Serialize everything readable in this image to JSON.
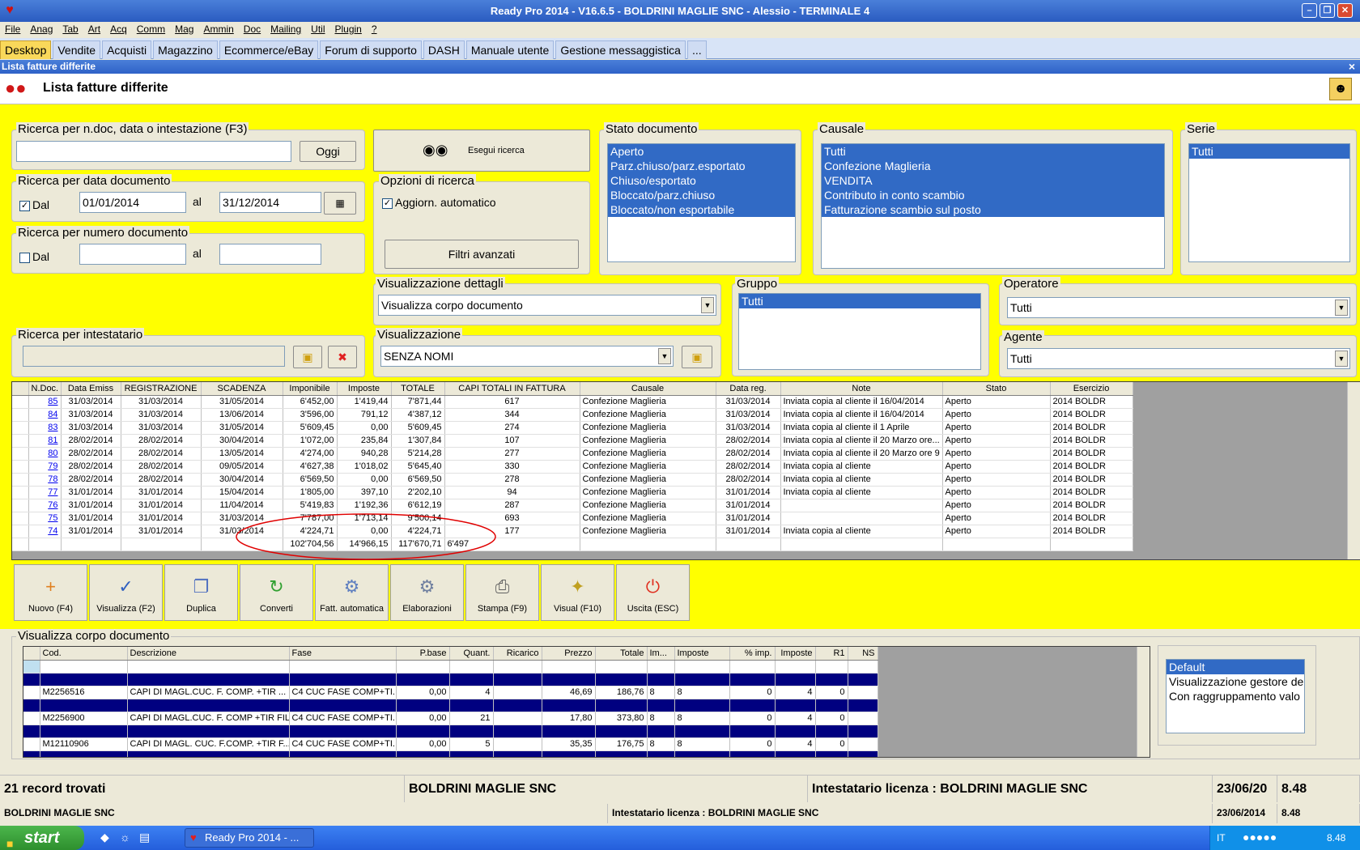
{
  "window": {
    "title": "Ready Pro 2014 - V16.6.5 - BOLDRINI MAGLIE SNC - Alessio - TERMINALE 4"
  },
  "menu": [
    "File",
    "Anag",
    "Tab",
    "Art",
    "Acq",
    "Comm",
    "Mag",
    "Ammin",
    "Doc",
    "Mailing",
    "Util",
    "Plugin",
    "?"
  ],
  "tabs": [
    "Desktop",
    "Vendite",
    "Acquisti",
    "Magazzino",
    "Ecommerce/eBay",
    "Forum di supporto",
    "DASH",
    "Manuale utente",
    "Gestione messaggistica",
    "..."
  ],
  "subwindow": {
    "title": "Lista fatture differite",
    "close": "×"
  },
  "header": {
    "title": "Lista fatture differite"
  },
  "search": {
    "group_label": "Ricerca per n.doc, data o intestazione (F3)",
    "value": "",
    "today_button": "Oggi"
  },
  "date_search": {
    "group_label": "Ricerca per data documento",
    "from_label": "Dal",
    "from": "01/01/2014",
    "to_label": "al",
    "to": "31/12/2014"
  },
  "number_search": {
    "group_label": "Ricerca per numero documento",
    "from_label": "Dal",
    "to_label": "al"
  },
  "execute": {
    "label": "Esegui ricerca"
  },
  "options": {
    "group_label": "Opzioni di ricerca",
    "auto_update": "Aggiorn. automatico",
    "advanced": "Filtri avanzati"
  },
  "stato": {
    "label": "Stato documento",
    "items": [
      "Aperto",
      "Parz.chiuso/parz.esportato",
      "Chiuso/esportato",
      "Bloccato/parz.chiuso",
      "Bloccato/non esportabile"
    ]
  },
  "causale": {
    "label": "Causale",
    "items": [
      "Tutti",
      "Confezione Maglieria",
      "VENDITA",
      "Contributo in conto scambio",
      "Fatturazione scambio sul posto"
    ]
  },
  "serie": {
    "label": "Serie",
    "items": [
      "Tutti"
    ]
  },
  "vis_dettagli": {
    "label": "Visualizzazione dettagli",
    "value": "Visualizza corpo documento"
  },
  "gruppo": {
    "label": "Gruppo",
    "items": [
      "Tutti"
    ]
  },
  "operatore": {
    "label": "Operatore",
    "value": "Tutti"
  },
  "intestatario": {
    "label": "Ricerca per intestatario"
  },
  "visualizzazione": {
    "label": "Visualizzazione",
    "value": "SENZA NOMI"
  },
  "agente": {
    "label": "Agente",
    "value": "Tutti"
  },
  "invoices": {
    "columns": [
      "N.Doc.",
      "Data Emiss",
      "REGISTRAZIONE",
      "SCADENZA",
      "Imponibile",
      "Imposte",
      "TOTALE",
      "CAPI TOTALI IN FATTURA",
      "Causale",
      "Data reg.",
      "Note",
      "Stato",
      "Esercizio"
    ],
    "rows": [
      [
        "85",
        "31/03/2014",
        "31/03/2014",
        "31/05/2014",
        "6'452,00",
        "1'419,44",
        "7'871,44",
        "617",
        "Confezione Maglieria",
        "31/03/2014",
        "Inviata copia al cliente il 16/04/2014",
        "Aperto",
        "2014 BOLDR"
      ],
      [
        "84",
        "31/03/2014",
        "31/03/2014",
        "13/06/2014",
        "3'596,00",
        "791,12",
        "4'387,12",
        "344",
        "Confezione Maglieria",
        "31/03/2014",
        "Inviata copia al cliente il 16/04/2014",
        "Aperto",
        "2014 BOLDR"
      ],
      [
        "83",
        "31/03/2014",
        "31/03/2014",
        "31/05/2014",
        "5'609,45",
        "0,00",
        "5'609,45",
        "274",
        "Confezione Maglieria",
        "31/03/2014",
        "Inviata copia al cliente il 1 Aprile",
        "Aperto",
        "2014 BOLDR"
      ],
      [
        "81",
        "28/02/2014",
        "28/02/2014",
        "30/04/2014",
        "1'072,00",
        "235,84",
        "1'307,84",
        "107",
        "Confezione Maglieria",
        "28/02/2014",
        "Inviata copia al cliente il 20 Marzo ore...",
        "Aperto",
        "2014 BOLDR"
      ],
      [
        "80",
        "28/02/2014",
        "28/02/2014",
        "13/05/2014",
        "4'274,00",
        "940,28",
        "5'214,28",
        "277",
        "Confezione Maglieria",
        "28/02/2014",
        "Inviata copia al cliente il 20 Marzo ore 9",
        "Aperto",
        "2014 BOLDR"
      ],
      [
        "79",
        "28/02/2014",
        "28/02/2014",
        "09/05/2014",
        "4'627,38",
        "1'018,02",
        "5'645,40",
        "330",
        "Confezione Maglieria",
        "28/02/2014",
        "Inviata copia al cliente",
        "Aperto",
        "2014 BOLDR"
      ],
      [
        "78",
        "28/02/2014",
        "28/02/2014",
        "30/04/2014",
        "6'569,50",
        "0,00",
        "6'569,50",
        "278",
        "Confezione Maglieria",
        "28/02/2014",
        "Inviata copia al cliente",
        "Aperto",
        "2014 BOLDR"
      ],
      [
        "77",
        "31/01/2014",
        "31/01/2014",
        "15/04/2014",
        "1'805,00",
        "397,10",
        "2'202,10",
        "94",
        "Confezione Maglieria",
        "31/01/2014",
        "Inviata copia al cliente",
        "Aperto",
        "2014 BOLDR"
      ],
      [
        "76",
        "31/01/2014",
        "31/01/2014",
        "11/04/2014",
        "5'419,83",
        "1'192,36",
        "6'612,19",
        "287",
        "Confezione Maglieria",
        "31/01/2014",
        "",
        "Aperto",
        "2014 BOLDR"
      ],
      [
        "75",
        "31/01/2014",
        "31/01/2014",
        "31/03/2014",
        "7'787,00",
        "1'713,14",
        "9'500,14",
        "693",
        "Confezione Maglieria",
        "31/01/2014",
        "",
        "Aperto",
        "2014 BOLDR"
      ],
      [
        "74",
        "31/01/2014",
        "31/01/2014",
        "31/03/2014",
        "4'224,71",
        "0,00",
        "4'224,71",
        "177",
        "Confezione Maglieria",
        "31/01/2014",
        "Inviata  copia al cliente",
        "Aperto",
        "2014 BOLDR"
      ]
    ],
    "totals": {
      "imponibile": "102'704,56",
      "imposte": "14'966,15",
      "totale": "117'670,71",
      "capi": "6'497"
    }
  },
  "toolbar": [
    "Nuovo (F4)",
    "Visualizza (F2)",
    "Duplica",
    "Converti",
    "Fatt. automatica",
    "Elaborazioni",
    "Stampa (F9)",
    "Visual (F10)",
    "Uscita (ESC)"
  ],
  "body": {
    "label": "Visualizza corpo documento",
    "columns": [
      "Cod.",
      "Descrizione",
      "Fase",
      "P.base",
      "Quant.",
      "Ricarico",
      "Prezzo",
      "Totale",
      "Im...",
      "Imposte",
      "% imp.",
      "Imposte",
      "R1",
      "NS"
    ],
    "rows": [
      [
        "M2256516",
        "CAPI DI MAGL.CUC. F.  COMP. +TIR ...",
        "C4 CUC FASE COMP+TI...",
        "0,00",
        "4",
        "",
        "46,69",
        "186,76",
        "8",
        "8",
        "0",
        "4",
        "0",
        ""
      ],
      [
        "M2256900",
        "CAPI DI MAGL.CUC. F. COMP +TIR FILI",
        "C4 CUC FASE COMP+TI...",
        "0,00",
        "21",
        "",
        "17,80",
        "373,80",
        "8",
        "8",
        "0",
        "4",
        "0",
        ""
      ],
      [
        "M12110906",
        "CAPI DI MAGL. CUC. F.COMP. +TIR F...",
        "C4 CUC FASE COMP+TI...",
        "0,00",
        "5",
        "",
        "35,35",
        "176,75",
        "8",
        "8",
        "0",
        "4",
        "0",
        ""
      ]
    ]
  },
  "layouts": [
    "Default",
    "Visualizzazione gestore de",
    "Con raggruppamento valo"
  ],
  "status": {
    "records": "21 record trovati",
    "company": "BOLDRINI MAGLIE SNC",
    "license": "Intestatario licenza : BOLDRINI MAGLIE SNC",
    "date": "23/06/20",
    "time": "8.48",
    "company2": "BOLDRINI MAGLIE SNC",
    "license2": "Intestatario licenza : BOLDRINI MAGLIE SNC",
    "date2": "23/06/2014",
    "time2": "8.48"
  },
  "taskbar": {
    "start": "start",
    "task": "Ready Pro 2014 - ...",
    "lang": "IT",
    "clock": "8.48"
  },
  "colors": {
    "accent_yellow": "#ffff00",
    "selection": "#316ac5",
    "annotation": "#e00000"
  }
}
